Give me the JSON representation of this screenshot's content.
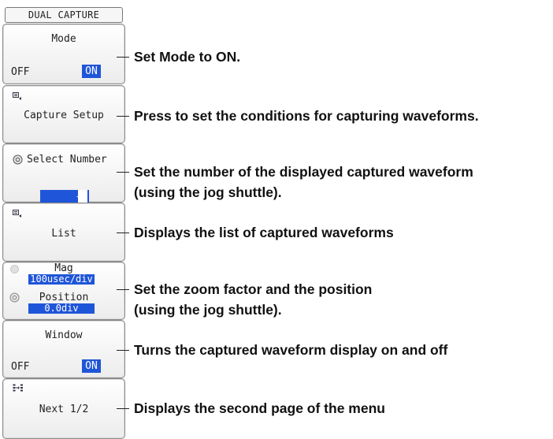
{
  "menu": {
    "title": "DUAL CAPTURE",
    "mode": {
      "label": "Mode",
      "off": "OFF",
      "on": "ON"
    },
    "capture_setup": {
      "label": "Capture Setup"
    },
    "select_number": {
      "label": "Select Number",
      "value": "-1"
    },
    "list": {
      "label": "List"
    },
    "zoom": {
      "mag_label": "Mag",
      "mag_value": "100usec/div",
      "position_label": "Position",
      "position_value": "0.0div"
    },
    "window": {
      "label": "Window",
      "off": "OFF",
      "on": "ON"
    },
    "next": {
      "label": "Next 1/2"
    }
  },
  "annotations": {
    "mode": "Set Mode to ON.",
    "capture_setup": "Press to set the conditions for capturing waveforms.",
    "select_number_1": "Set the number of the displayed captured waveform",
    "select_number_2": "(using the jog shuttle).",
    "list": "Displays the list of captured waveforms",
    "zoom_1": "Set the zoom factor and the position",
    "zoom_2": "(using the jog shuttle).",
    "window": "Turns the captured waveform display on and off",
    "next": "Displays the second page of the menu"
  },
  "colors": {
    "highlight": "#1f55d8"
  },
  "icons": [
    "menu-icon",
    "jog-shuttle-icon",
    "next-page-icon"
  ]
}
